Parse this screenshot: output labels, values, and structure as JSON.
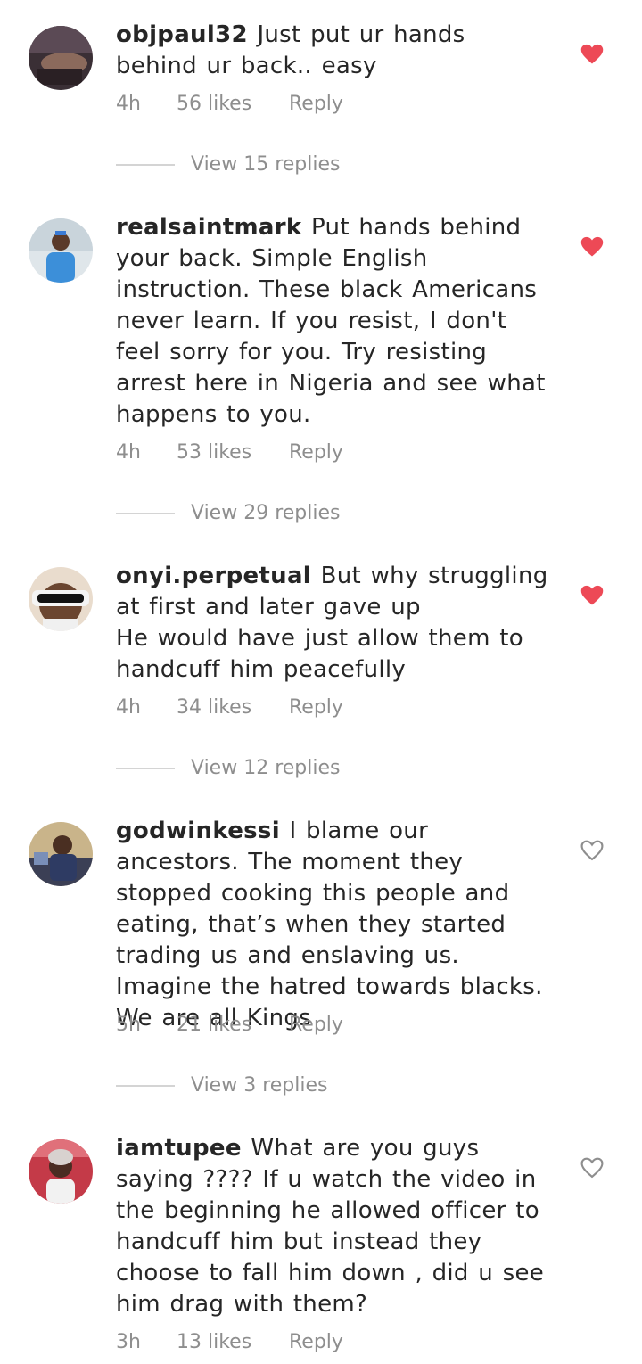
{
  "colors": {
    "liked_heart": "#ed4956",
    "unliked_heart": "#8e8e8e",
    "meta_text": "#8e8e8e",
    "body_text": "#262626"
  },
  "comments": [
    {
      "username": "objpaul32",
      "text": "Just put ur hands behind ur back.. easy",
      "time": "4h",
      "likes": "56 likes",
      "reply_label": "Reply",
      "liked": true,
      "view_replies": "View 15 replies",
      "heart_icon": "heart-filled-icon"
    },
    {
      "username": "realsaintmark",
      "text": "Put hands behind your back. Simple English instruction. These black Americans never learn. If you resist, I don't feel sorry for you. Try resisting arrest here in Nigeria and see what happens to you.",
      "time": "4h",
      "likes": "53 likes",
      "reply_label": "Reply",
      "liked": true,
      "view_replies": "View 29 replies",
      "heart_icon": "heart-filled-icon"
    },
    {
      "username": "onyi.perpetual",
      "text": "But why struggling at first and later gave up\nHe would have just allow them to handcuff him peacefully",
      "time": "4h",
      "likes": "34 likes",
      "reply_label": "Reply",
      "liked": true,
      "view_replies": "View 12 replies",
      "heart_icon": "heart-filled-icon"
    },
    {
      "username": "godwinkessi",
      "text": "I blame our ancestors. The moment they stopped cooking this people and eating, that’s when they started trading us and enslaving us. Imagine the hatred towards blacks. We are all Kings",
      "time": "5h",
      "likes": "21 likes",
      "reply_label": "Reply",
      "liked": false,
      "view_replies": "View 3 replies",
      "heart_icon": "heart-outline-icon"
    },
    {
      "username": "iamtupee",
      "text": "What are you guys saying ???? If u watch the video in the beginning he allowed officer to handcuff him but instead they choose to fall him down , did u see him drag with them?",
      "time": "3h",
      "likes": "13 likes",
      "reply_label": "Reply",
      "liked": false,
      "heart_icon": "heart-outline-icon"
    }
  ]
}
